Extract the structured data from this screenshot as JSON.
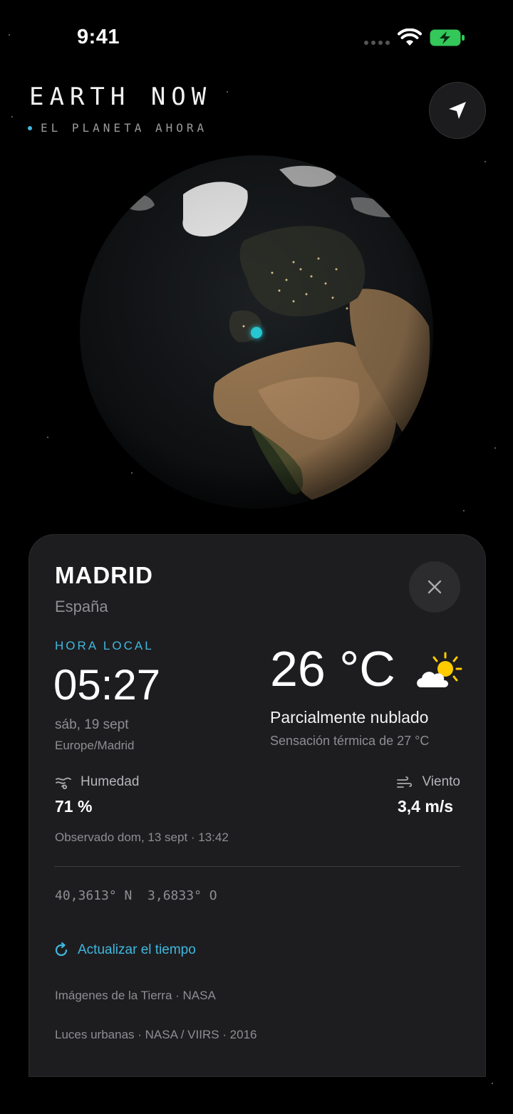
{
  "status_bar": {
    "time": "9:41"
  },
  "header": {
    "title": "EARTH NOW",
    "subtitle": "EL PLANETA AHORA"
  },
  "location_card": {
    "city": "MADRID",
    "country": "España",
    "local_time_label": "HORA LOCAL",
    "local_time": "05:27",
    "date": "sáb, 19 sept",
    "timezone": "Europe/Madrid",
    "temperature": "26 °C",
    "condition": "Parcialmente nublado",
    "feels_like": "Sensación térmica de 27 °C",
    "humidity_label": "Humedad",
    "humidity_value": "71 %",
    "wind_label": "Viento",
    "wind_value": "3,4 m/s",
    "observed": "Observado dom, 13 sept · 13:42",
    "coordinates": "40,3613° N  3,6833° O",
    "refresh_label": "Actualizar el tiempo",
    "credit_earth": "Imágenes de la Tierra · NASA",
    "credit_lights": "Luces urbanas · NASA / VIIRS · 2016"
  },
  "icons": {
    "locate": "location-arrow-icon",
    "close": "close-icon",
    "weather": "partly-cloudy-icon",
    "humidity": "humidity-icon",
    "wind": "wind-icon",
    "refresh": "refresh-icon"
  },
  "colors": {
    "accent": "#3fb8e0",
    "marker": "#27c6d1",
    "card_background": "#1d1d1f",
    "battery": "#34c759",
    "sun": "#ffcc00"
  }
}
